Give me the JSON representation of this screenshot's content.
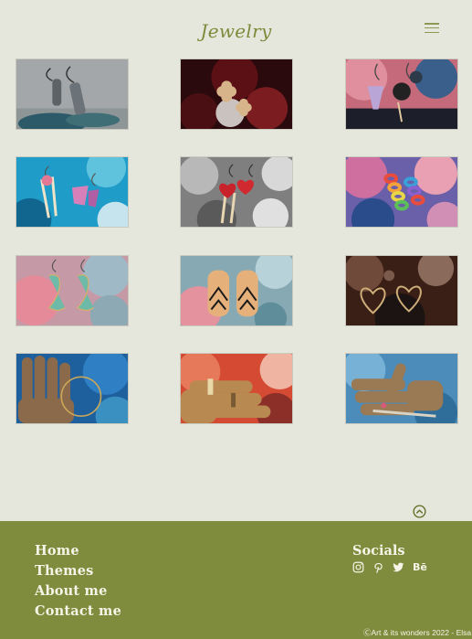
{
  "header": {
    "title": "Jewelry",
    "menu_icon": "hamburger-icon"
  },
  "gallery": {
    "items": [
      {
        "subject": "silver-drop-earrings",
        "bg": "#9fa4a6"
      },
      {
        "subject": "gold-flower-earrings",
        "bg": "#3b0d10"
      },
      {
        "subject": "crystal-and-black-earrings",
        "bg": "#c9727e"
      },
      {
        "subject": "pink-crystal-earrings",
        "bg": "#1e9fc9"
      },
      {
        "subject": "red-heart-earrings",
        "bg": "#8c8c8c"
      },
      {
        "subject": "rainbow-chain-earrings",
        "bg": "#6a5ea9"
      },
      {
        "subject": "teal-dragon-earrings",
        "bg": "#c49aa6"
      },
      {
        "subject": "wing-pattern-earrings",
        "bg": "#7da7b3"
      },
      {
        "subject": "heart-wire-earrings",
        "bg": "#3e2216"
      },
      {
        "subject": "hoop-on-wooden-hand",
        "bg": "#1e5f9e"
      },
      {
        "subject": "rings-on-wooden-hand",
        "bg": "#d2452f"
      },
      {
        "subject": "bracelet-on-wooden-hand",
        "bg": "#4f8cba"
      }
    ]
  },
  "back_to_top": {
    "icon": "chevron-up-circle-icon"
  },
  "footer": {
    "nav": [
      "Home",
      "Themes",
      "About me",
      "Contact me"
    ],
    "socials_title": "Socials",
    "social_icons": [
      "instagram-icon",
      "pinterest-icon",
      "twitter-icon",
      "behance-icon"
    ],
    "behance_text": "Bē",
    "copyright": "ⒸArt & its wonders 2022 - Elsa",
    "bg": "#7f8b3d"
  }
}
